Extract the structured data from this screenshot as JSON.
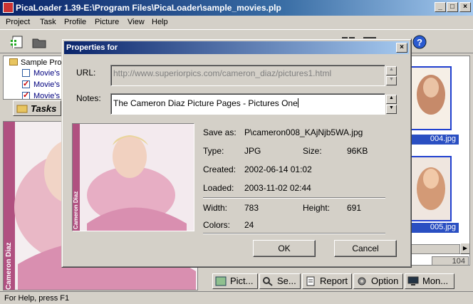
{
  "app": {
    "title": "PicaLoader 1.39-E:\\Program Files\\PicaLoader\\sample_movies.plp",
    "menu": [
      "Project",
      "Task",
      "Profile",
      "Picture",
      "View",
      "Help"
    ],
    "tree_root": "Sample Proj",
    "tree_items": [
      "Movie's",
      "Movie's",
      "Movie's"
    ],
    "tasks_label": "Tasks",
    "thumb_labels": [
      "004.jpg",
      "005.jpg"
    ],
    "counter": "104",
    "bottom_tabs": [
      "Pict...",
      "Se...",
      "Report",
      "Option",
      "Mon..."
    ],
    "status": "For Help, press F1",
    "preview_caption": "Cameron Diaz"
  },
  "dialog": {
    "title": "Properties for",
    "url_label": "URL:",
    "url_value": "http://www.superiorpics.com/cameron_diaz/pictures1.html",
    "notes_label": "Notes:",
    "notes_value": "The Cameron Diaz Picture Pages - Pictures One",
    "image_caption": "Cameron Diaz",
    "saveas_label": "Save as:",
    "saveas_value": "P\\cameron008_KAjNjb5WA.jpg",
    "type_label": "Type:",
    "type_value": "JPG",
    "size_label": "Size:",
    "size_value": "96KB",
    "created_label": "Created:",
    "created_value": "2002-06-14 01:02",
    "loaded_label": "Loaded:",
    "loaded_value": "2003-11-02 02:44",
    "width_label": "Width:",
    "width_value": "783",
    "height_label": "Height:",
    "height_value": "691",
    "colors_label": "Colors:",
    "colors_value": "24",
    "ok_label": "OK",
    "cancel_label": "Cancel"
  },
  "colors": {
    "title_active": "#0a246a",
    "face": "#d4d0c8",
    "photo_pink": "#d98fb0"
  }
}
